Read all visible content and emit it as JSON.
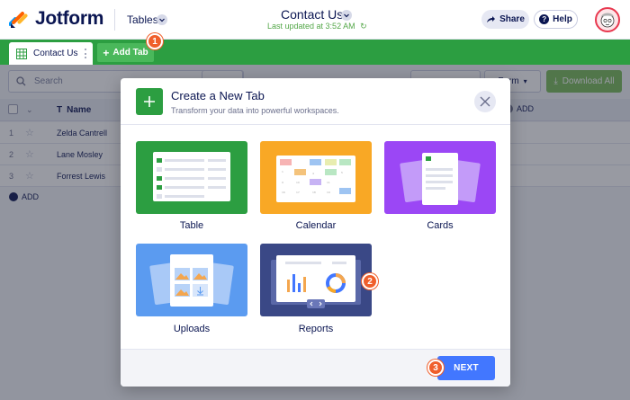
{
  "header": {
    "brand": "Jotform",
    "section_label": "Tables",
    "form_title": "Contact Us",
    "updated_text": "Last updated at 3:52 AM",
    "share_label": "Share",
    "help_label": "Help",
    "accent_color": "#2c9e41"
  },
  "tabs": {
    "active_label": "Contact Us",
    "add_label": "Add Tab"
  },
  "toolbar": {
    "search_placeholder": "Search",
    "form_label": "Form",
    "download_label": "Download All"
  },
  "table": {
    "name_header": "Name",
    "add_column_label": "ADD",
    "rows": [
      {
        "num": "1",
        "name": "Zelda Cantrell"
      },
      {
        "num": "2",
        "name": "Lane Mosley"
      },
      {
        "num": "3",
        "name": "Forrest Lewis"
      }
    ],
    "add_row_label": "ADD"
  },
  "modal": {
    "title": "Create a New Tab",
    "subtitle": "Transform your data into powerful workspaces.",
    "options": [
      {
        "label": "Table",
        "color": "#2c9e41"
      },
      {
        "label": "Calendar",
        "color": "#f9a825"
      },
      {
        "label": "Cards",
        "color": "#9b47f5"
      },
      {
        "label": "Uploads",
        "color": "#5b9bf0"
      },
      {
        "label": "Reports",
        "color": "#3a4886"
      }
    ],
    "next_label": "NEXT"
  },
  "steps": [
    "1",
    "2",
    "3"
  ]
}
